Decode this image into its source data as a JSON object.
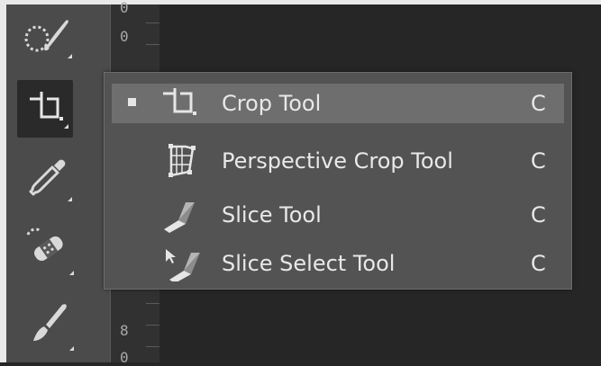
{
  "toolbar": {
    "tools": [
      {
        "name": "quick-selection"
      },
      {
        "name": "crop",
        "active": true
      },
      {
        "name": "eyedropper"
      },
      {
        "name": "spot-healing-brush"
      },
      {
        "name": "brush"
      }
    ]
  },
  "ruler": {
    "digits_top": [
      "0",
      "0"
    ],
    "digits_bottom": [
      "8",
      "0"
    ]
  },
  "flyout": {
    "items": [
      {
        "label": "Crop Tool",
        "shortcut": "C",
        "icon": "crop-icon",
        "selected": true
      },
      {
        "label": "Perspective Crop Tool",
        "shortcut": "C",
        "icon": "perspective-crop-icon",
        "selected": false
      },
      {
        "label": "Slice Tool",
        "shortcut": "C",
        "icon": "slice-icon",
        "selected": false
      },
      {
        "label": "Slice Select Tool",
        "shortcut": "C",
        "icon": "slice-select-icon",
        "selected": false
      }
    ]
  },
  "colors": {
    "toolbar": "#4b4b4b",
    "flyout": "#535353",
    "selected_row": "#6e6e6e",
    "text": "#e8e8e8"
  }
}
